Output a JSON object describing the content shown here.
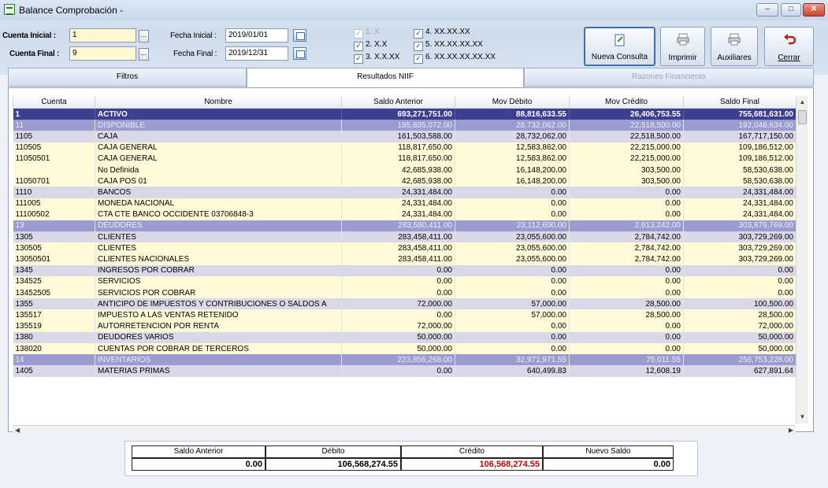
{
  "window": {
    "title": "Balance Comprobación -"
  },
  "filters": {
    "cuenta_inicial_label": "Cuenta Inicial :",
    "cuenta_inicial_value": "1",
    "cuenta_final_label": "Cuenta Final :",
    "cuenta_final_value": "9",
    "fecha_inicial_label": "Fecha Inicial :",
    "fecha_inicial_value": "2019/01/01",
    "fecha_final_label": "Fecha Final :",
    "fecha_final_value": "2019/12/31",
    "ellipsis": "..."
  },
  "levels": [
    {
      "label": "1. X",
      "checked": true,
      "enabled": false
    },
    {
      "label": "2. X.X",
      "checked": true,
      "enabled": true
    },
    {
      "label": "3. X.X.XX",
      "checked": true,
      "enabled": true
    },
    {
      "label": "4. XX.XX.XX",
      "checked": true,
      "enabled": true
    },
    {
      "label": "5. XX.XX.XX.XX",
      "checked": true,
      "enabled": true
    },
    {
      "label": "6. XX.XX.XX.XX.XX",
      "checked": true,
      "enabled": true
    }
  ],
  "toolbar": {
    "nueva_consulta": "Nueva Consulta",
    "imprimir": "Imprimir",
    "auxiliares": "Auxiliares",
    "cerrar": "Cerrar"
  },
  "tabs": [
    "Filtros",
    "Resultados NIIF",
    "Razones Financieras"
  ],
  "columns": [
    "Cuenta",
    "Nombre",
    "Saldo Anterior",
    "Mov Débito",
    "Mov Crédito",
    "Saldo Final"
  ],
  "rows": [
    {
      "style": "sel",
      "cells": [
        "1",
        "ACTIVO",
        "693,271,751.00",
        "88,816,633.55",
        "26,406,753.55",
        "755,681,631.00"
      ]
    },
    {
      "style": "grp",
      "cells": [
        "11",
        "DISPONIBLE",
        "185,835,072.00",
        "28,732,062.00",
        "22,518,500.00",
        "192,048,634.00"
      ]
    },
    {
      "style": "odd",
      "cells": [
        "1105",
        "CAJA",
        "161,503,588.00",
        "28,732,062.00",
        "22,518,500.00",
        "167,717,150.00"
      ]
    },
    {
      "style": "even",
      "cells": [
        "110505",
        "CAJA GENERAL",
        "118,817,650.00",
        "12,583,862.00",
        "22,215,000.00",
        "109,186,512.00"
      ]
    },
    {
      "style": "even",
      "cells": [
        "11050501",
        "CAJA GENERAL",
        "118,817,650.00",
        "12,583,862.00",
        "22,215,000.00",
        "109,186,512.00"
      ]
    },
    {
      "style": "even",
      "cells": [
        "",
        "No Definida",
        "42,685,938.00",
        "16,148,200.00",
        "303,500.00",
        "58,530,638.00"
      ]
    },
    {
      "style": "even",
      "cells": [
        "11050701",
        "CAJA POS 01",
        "42,685,938.00",
        "16,148,200.00",
        "303,500.00",
        "58,530,638.00"
      ]
    },
    {
      "style": "odd",
      "cells": [
        "1110",
        "BANCOS",
        "24,331,484.00",
        "0.00",
        "0.00",
        "24,331,484.00"
      ]
    },
    {
      "style": "even",
      "cells": [
        "111005",
        "MONEDA NACIONAL",
        "24,331,484.00",
        "0.00",
        "0.00",
        "24,331,484.00"
      ]
    },
    {
      "style": "even",
      "cells": [
        "11100502",
        "CTA CTE BANCO OCCIDENTE 03706848-3",
        "24,331,484.00",
        "0.00",
        "0.00",
        "24,331,484.00"
      ]
    },
    {
      "style": "grp",
      "cells": [
        "13",
        "DEUDORES",
        "283,580,411.00",
        "23,112,600.00",
        "2,813,242.00",
        "303,879,769.00"
      ]
    },
    {
      "style": "odd",
      "cells": [
        "1305",
        "CLIENTES",
        "283,458,411.00",
        "23,055,600.00",
        "2,784,742.00",
        "303,729,269.00"
      ]
    },
    {
      "style": "even",
      "cells": [
        "130505",
        "CLIENTES",
        "283,458,411.00",
        "23,055,600.00",
        "2,784,742.00",
        "303,729,269.00"
      ]
    },
    {
      "style": "even",
      "cells": [
        "13050501",
        "CLIENTES NACIONALES",
        "283,458,411.00",
        "23,055,600.00",
        "2,784,742.00",
        "303,729,269.00"
      ]
    },
    {
      "style": "odd",
      "cells": [
        "1345",
        "INGRESOS POR COBRAR",
        "0.00",
        "0.00",
        "0.00",
        "0.00"
      ]
    },
    {
      "style": "even",
      "cells": [
        "134525",
        "SERVICIOS",
        "0.00",
        "0.00",
        "0.00",
        "0.00"
      ]
    },
    {
      "style": "even",
      "cells": [
        "13452505",
        "SERVICIOS POR COBRAR",
        "0.00",
        "0.00",
        "0.00",
        "0.00"
      ]
    },
    {
      "style": "odd",
      "cells": [
        "1355",
        "ANTICIPO DE IMPUESTOS Y CONTRIBUCIONES O SALDOS A",
        "72,000.00",
        "57,000.00",
        "28,500.00",
        "100,500.00"
      ]
    },
    {
      "style": "even",
      "cells": [
        "135517",
        "IMPUESTO A LAS VENTAS RETENIDO",
        "0.00",
        "57,000.00",
        "28,500.00",
        "28,500.00"
      ]
    },
    {
      "style": "even",
      "cells": [
        "135519",
        "AUTORRETENCION POR RENTA",
        "72,000.00",
        "0.00",
        "0.00",
        "72,000.00"
      ]
    },
    {
      "style": "odd",
      "cells": [
        "1380",
        "DEUDORES VARIOS",
        "50,000.00",
        "0.00",
        "0.00",
        "50,000.00"
      ]
    },
    {
      "style": "even",
      "cells": [
        "138020",
        "CUENTAS POR COBRAR DE TERCEROS",
        "50,000.00",
        "0.00",
        "0.00",
        "50,000.00"
      ]
    },
    {
      "style": "grp",
      "cells": [
        "14",
        "INVENTARIOS",
        "223,856,268.00",
        "32,971,971.55",
        "75,011.55",
        "256,753,228.00"
      ]
    },
    {
      "style": "odd",
      "cells": [
        "1405",
        "MATERIAS PRIMAS",
        "0.00",
        "640,499.83",
        "12,608.19",
        "627,891.64"
      ]
    }
  ],
  "totals": {
    "headers": [
      "Saldo Anterior",
      "Débito",
      "Crédito",
      "Nuevo Saldo"
    ],
    "values": [
      "0.00",
      "106,568,274.55",
      "106,568,274.55",
      "0.00"
    ],
    "credit_color": "#cc0000"
  }
}
